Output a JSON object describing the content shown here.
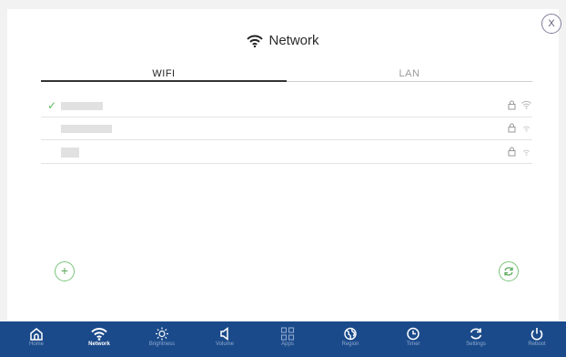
{
  "header": {
    "title": "Network",
    "title_icon": "wifi-icon",
    "close_label": "X"
  },
  "tabs": [
    {
      "label": "WIFI",
      "active": true
    },
    {
      "label": "LAN",
      "active": false
    }
  ],
  "networks": [
    {
      "connected": true,
      "ssid_visible": false,
      "secured": true,
      "signal": "strong",
      "check": "✓"
    },
    {
      "connected": false,
      "ssid_visible": false,
      "secured": true,
      "signal": "weak"
    },
    {
      "connected": false,
      "ssid_visible": false,
      "secured": true,
      "signal": "weak"
    }
  ],
  "actions": {
    "add_label": "+",
    "refresh_icon": "refresh-icon"
  },
  "colors": {
    "nav_bg": "#1a4a8a",
    "accent_green": "#5cb85c"
  },
  "nav": [
    {
      "label": "Home",
      "icon": "home-icon",
      "active": false
    },
    {
      "label": "Network",
      "icon": "wifi-icon",
      "active": true
    },
    {
      "label": "Brightness",
      "icon": "brightness-icon",
      "active": false
    },
    {
      "label": "Volume",
      "icon": "volume-icon",
      "active": false
    },
    {
      "label": "Apps",
      "icon": "apps-icon",
      "active": false
    },
    {
      "label": "Region",
      "icon": "globe-icon",
      "active": false
    },
    {
      "label": "Timer",
      "icon": "clock-icon",
      "active": false
    },
    {
      "label": "Settings",
      "icon": "refresh-icon",
      "active": false
    },
    {
      "label": "Reboot",
      "icon": "power-icon",
      "active": false
    }
  ]
}
